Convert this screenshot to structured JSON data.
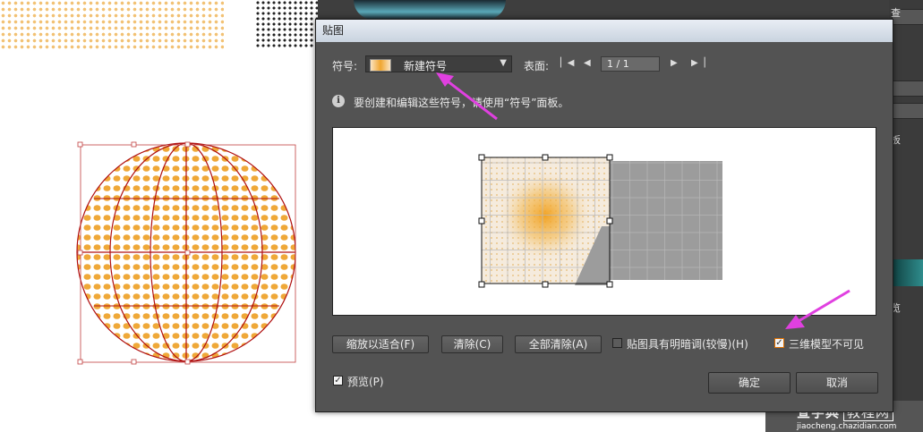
{
  "dialog": {
    "title": "贴图",
    "symbol_label": "符号:",
    "symbol_value": "新建符号",
    "surface_label": "表面:",
    "page_value": "1 / 1",
    "info_text": "要创建和编辑这些符号，请使用“符号”面板。",
    "buttons": {
      "scale_to_fit": "缩放以适合(F)",
      "clear": "清除(C)",
      "clear_all": "全部清除(A)",
      "ok": "确定",
      "cancel": "取消"
    },
    "checkboxes": {
      "shade_artwork": {
        "label": "贴图具有明暗调(较慢)(H)",
        "checked": false
      },
      "invisible_geometry": {
        "label": "三维模型不可见",
        "checked": true
      },
      "preview": {
        "label": "预览(P)",
        "checked": true
      }
    }
  },
  "right_panel": {
    "labels": [
      "查",
      "板",
      "览"
    ]
  },
  "watermark": {
    "main": "查字典",
    "boxed": "教程网",
    "url": "jiaocheng.chazidian.com"
  },
  "colors": {
    "dialog_bg": "#535353",
    "accent_arrow": "#e040e0",
    "dot_orange": "#f0a630",
    "wire_red": "#b01010"
  }
}
